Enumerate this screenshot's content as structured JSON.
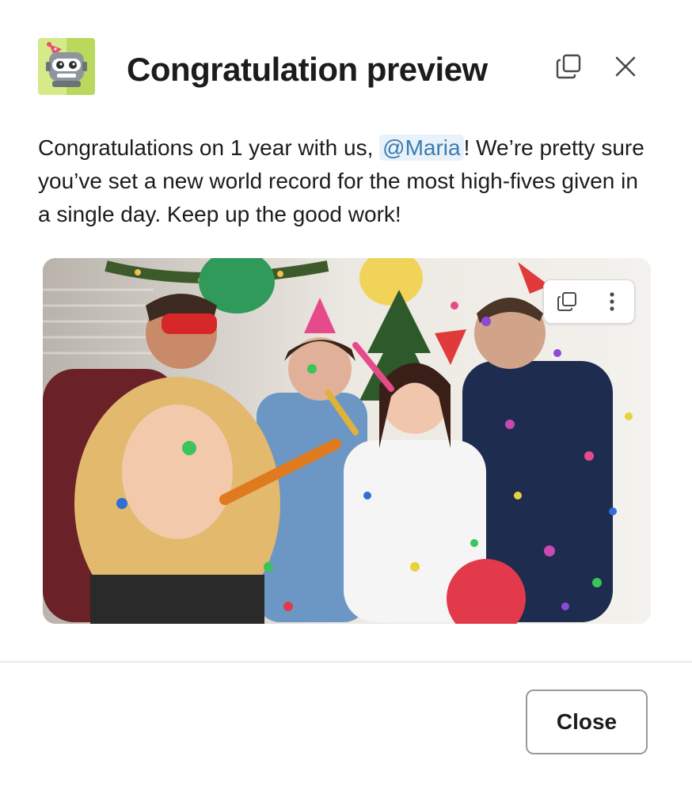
{
  "modal": {
    "title": "Congratulation preview",
    "icons": {
      "app": "party-robot-icon",
      "copy": "copy-icon",
      "close": "close-icon"
    }
  },
  "message": {
    "before_mention": "Congratulations on 1 year with us, ",
    "mention": "@Maria",
    "after_mention": "! We’re pretty sure you’ve set a new world record for the most high-fives given in a single day. Keep up the good work!"
  },
  "image": {
    "description_icon": "party-photo",
    "toolbar": {
      "copy_icon": "copy-icon",
      "more_icon": "more-vertical-icon"
    }
  },
  "footer": {
    "close_label": "Close"
  },
  "colors": {
    "mention_bg": "#e8f2fb",
    "mention_text": "#3d7cae",
    "app_icon_bg": "#c8e07a"
  }
}
